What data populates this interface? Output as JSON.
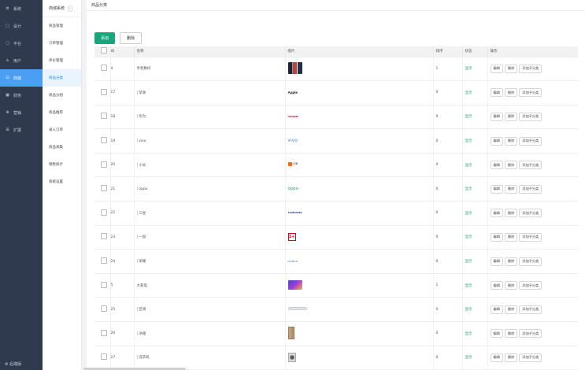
{
  "sidebar": {
    "items": [
      {
        "icon": "gear-icon",
        "glyph": "⚙",
        "label": "系统"
      },
      {
        "icon": "document-icon",
        "glyph": "▢",
        "label": "设计"
      },
      {
        "icon": "document-icon",
        "glyph": "▢",
        "label": "平台"
      },
      {
        "icon": "user-icon",
        "glyph": "♙",
        "label": "用户"
      },
      {
        "icon": "store-icon",
        "glyph": "⊡",
        "label": "商城",
        "active": true
      },
      {
        "icon": "finance-icon",
        "glyph": "▣",
        "label": "财务"
      },
      {
        "icon": "marketing-icon",
        "glyph": "⊕",
        "label": "营销"
      },
      {
        "icon": "extension-icon",
        "glyph": "⊞",
        "label": "扩展"
      }
    ],
    "bottom_label": "⚙ 后端版"
  },
  "subnav": {
    "title": "商城系统",
    "collapse_glyph": "‹",
    "items": [
      {
        "label": "商品管理"
      },
      {
        "label": "订单管理"
      },
      {
        "label": "评价管理"
      },
      {
        "label": "商品分类",
        "active": true
      },
      {
        "label": "商品分组"
      },
      {
        "label": "商品推荐"
      },
      {
        "label": "录入订单"
      },
      {
        "label": "商品采集"
      },
      {
        "label": "销售统计"
      },
      {
        "label": "系统设置"
      }
    ]
  },
  "breadcrumb": "商品分类",
  "toolbar": {
    "add_label": "添加",
    "delete_label": "删除"
  },
  "table": {
    "headers": [
      "ID",
      "名称",
      "图片",
      "排序",
      "状态",
      "操作"
    ],
    "rows": [
      {
        "id": "4",
        "name": "手机数码",
        "thumb": "phone",
        "sort": "1",
        "state": "显示"
      },
      {
        "id": "17",
        "name": "┆苹果",
        "thumb": "apple",
        "thumb_text": "Apple",
        "sort": "0",
        "state": "显示"
      },
      {
        "id": "18",
        "name": "┆华为",
        "thumb": "huawei",
        "thumb_text": "HUAWEI",
        "sort": "0",
        "state": "显示"
      },
      {
        "id": "19",
        "name": "┆vivo",
        "thumb": "vivo",
        "thumb_text": "vivo",
        "sort": "0",
        "state": "显示"
      },
      {
        "id": "20",
        "name": "┆小米",
        "thumb": "mi",
        "thumb_text": "小米",
        "sort": "0",
        "state": "显示"
      },
      {
        "id": "21",
        "name": "┆oppo",
        "thumb": "oppo",
        "thumb_text": "oppo",
        "sort": "0",
        "state": "显示"
      },
      {
        "id": "22",
        "name": "┆三星",
        "thumb": "samsung",
        "thumb_text": "SAMSUNG",
        "sort": "0",
        "state": "显示"
      },
      {
        "id": "23",
        "name": "┆一加",
        "thumb": "oneplus",
        "thumb_text": "1+",
        "sort": "0",
        "state": "显示"
      },
      {
        "id": "24",
        "name": "┆荣耀",
        "thumb": "honor",
        "thumb_text": "HONOR",
        "sort": "0",
        "state": "显示"
      },
      {
        "id": "5",
        "name": "大家电",
        "thumb": "appliance",
        "sort": "1",
        "state": "显示"
      },
      {
        "id": "25",
        "name": "┆空调",
        "thumb": "ac",
        "sort": "0",
        "state": "显示"
      },
      {
        "id": "26",
        "name": "┆冰箱",
        "thumb": "fridge",
        "sort": "0",
        "state": "显示"
      },
      {
        "id": "27",
        "name": "┆洗衣机",
        "thumb": "washer",
        "sort": "0",
        "state": "显示"
      }
    ],
    "actions": [
      "编辑",
      "删除",
      "添加子分类"
    ]
  },
  "colors": {
    "accent": "#19a67d",
    "sidebar_bg": "#2f3a4f",
    "active_blue": "#4a9ff5"
  }
}
